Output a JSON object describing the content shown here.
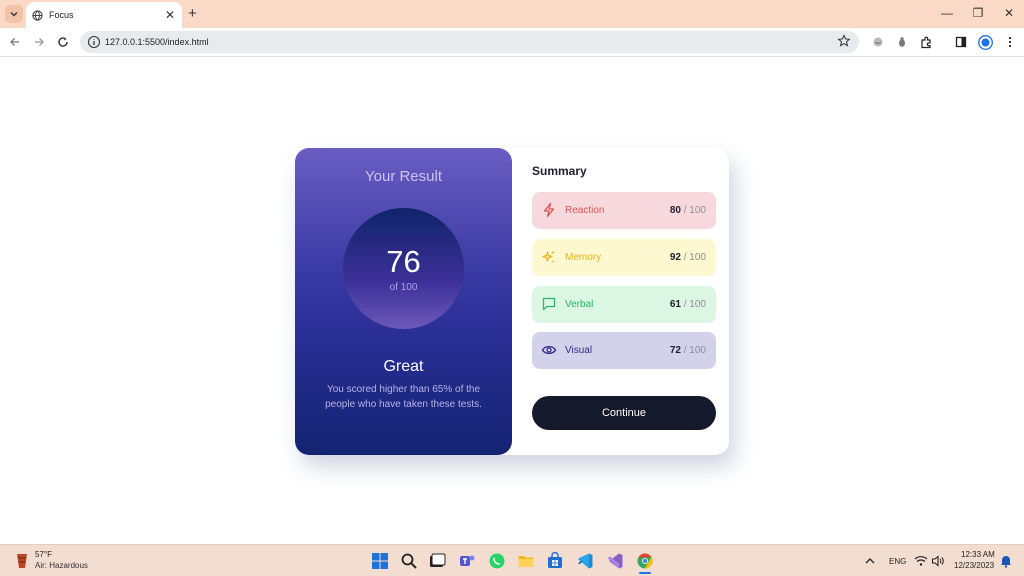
{
  "browser": {
    "tab_title": "Focus",
    "tab_close": "✕",
    "new_tab": "+",
    "url": "127.0.0.1:5500/index.html",
    "window_controls": {
      "minimize": "—",
      "restore": "❐",
      "close": "✕"
    }
  },
  "result": {
    "heading": "Your Result",
    "score": "76",
    "score_of": "of 100",
    "grade": "Great",
    "description": "You scored higher than 65% of the people who have taken these tests."
  },
  "summary": {
    "title": "Summary",
    "items": [
      {
        "label": "Reaction",
        "score": "80",
        "max": "/ 100",
        "icon": "lightning-icon",
        "color": "#e05454",
        "bg": "#f7d8dc"
      },
      {
        "label": "Memory",
        "score": "92",
        "max": "/ 100",
        "icon": "sparkles-icon",
        "color": "#e9b320",
        "bg": "#fdf8cf"
      },
      {
        "label": "Verbal",
        "score": "61",
        "max": "/ 100",
        "icon": "chat-bubble-icon",
        "color": "#27b868",
        "bg": "#dcf6e4"
      },
      {
        "label": "Visual",
        "score": "72",
        "max": "/ 100",
        "icon": "eye-icon",
        "color": "#2f2d88",
        "bg": "#d4d1ea"
      }
    ],
    "button": "Continue"
  },
  "taskbar": {
    "weather_temp": "57°F",
    "weather_desc": "Air: Hazardous",
    "language": "ENG",
    "time": "12:33 AM",
    "date": "12/23/2023"
  },
  "colors": {
    "result_gradient_top": "#6a5dc2",
    "result_gradient_bottom": "#132371",
    "button_bg": "#141a2b"
  }
}
